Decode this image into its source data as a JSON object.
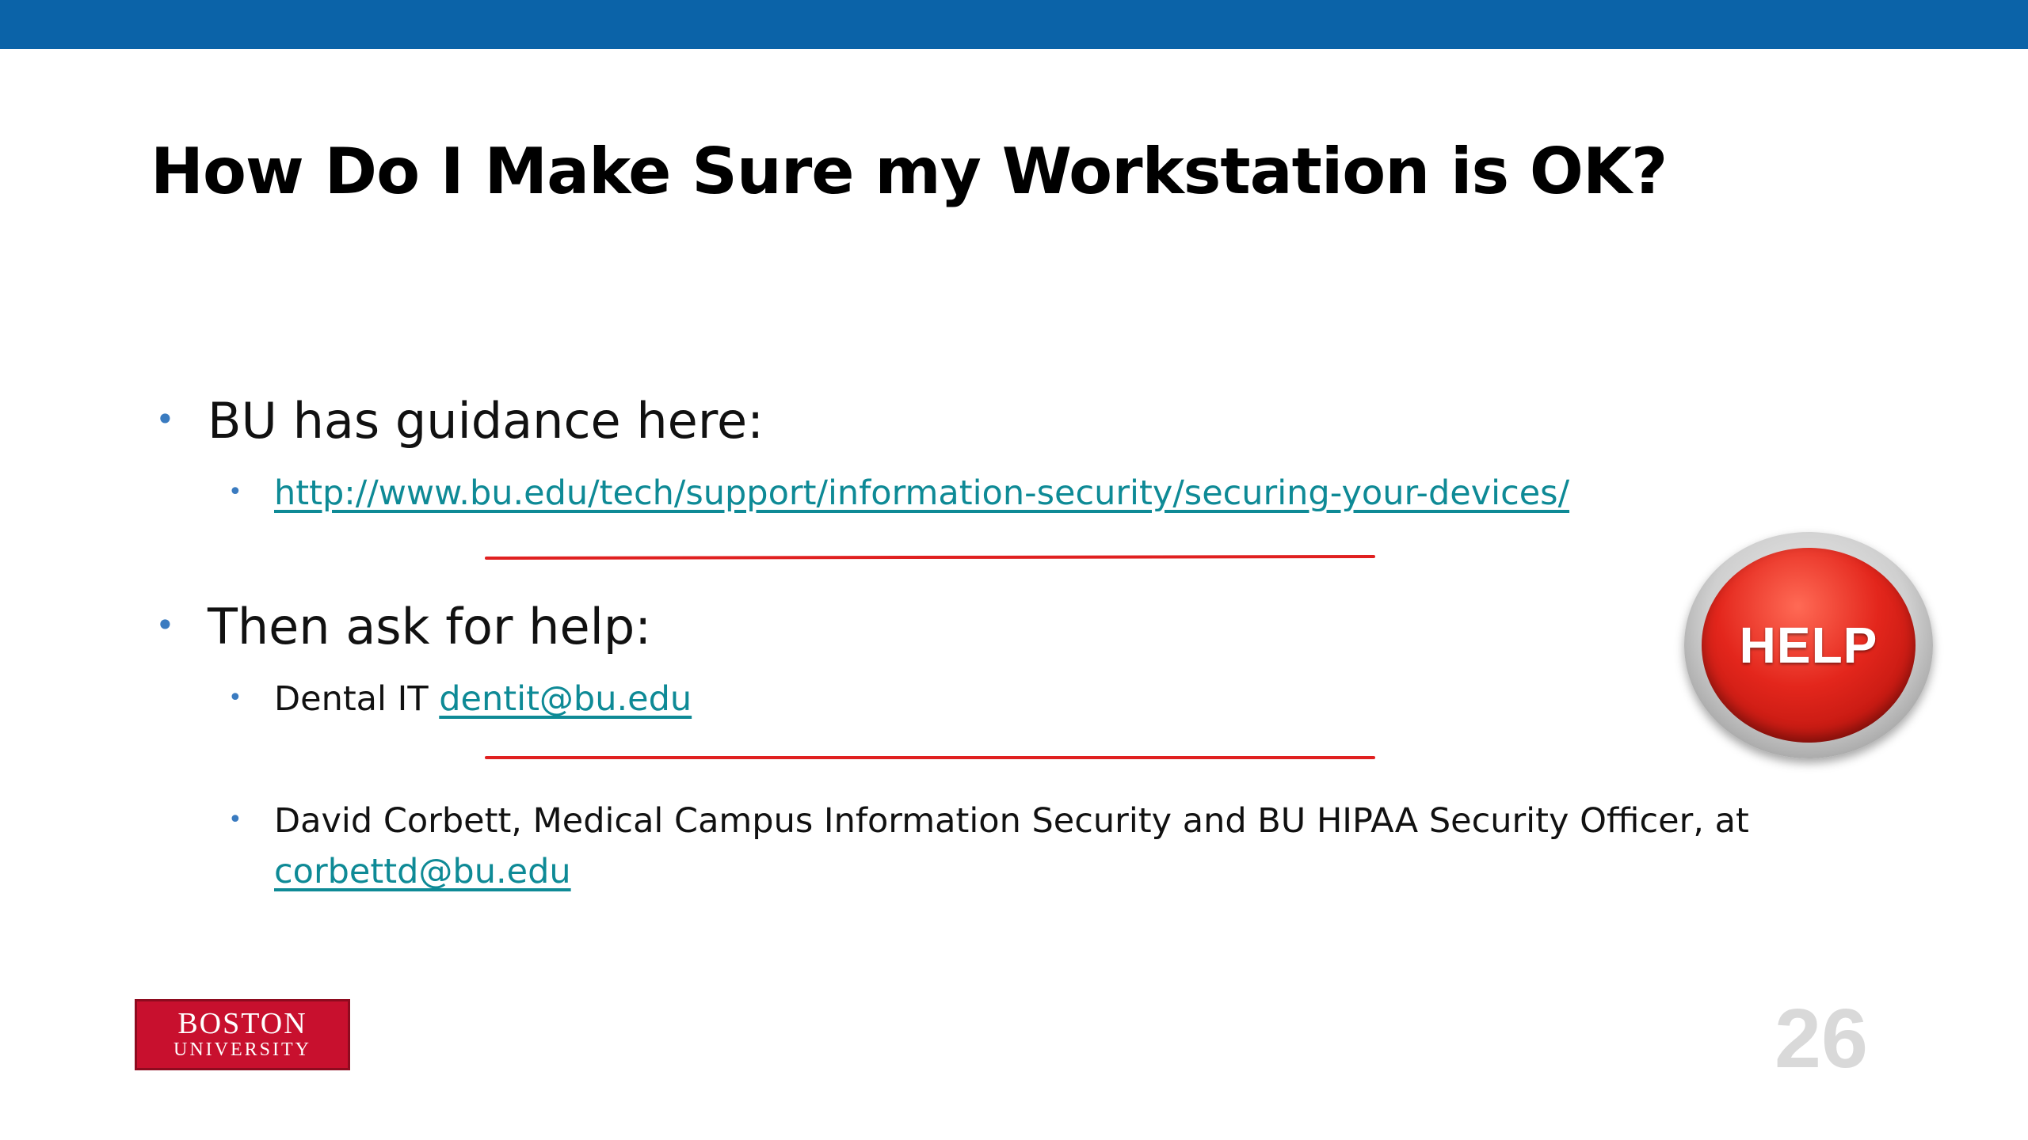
{
  "colors": {
    "header_bar": "#0b63a8",
    "bullet": "#3a7bc0",
    "link": "#0e8a96",
    "annotation_line": "#e02020",
    "logo_red": "#c8102e"
  },
  "slide": {
    "title": "How Do I Make Sure my Workstation is OK?",
    "bullets": [
      {
        "text": "BU has guidance here:",
        "sub": [
          {
            "link": "http://www.bu.edu/tech/support/information-security/securing-your-devices/"
          }
        ]
      },
      {
        "text": "Then ask for help:",
        "sub": [
          {
            "prefix": "Dental IT ",
            "link": "dentit@bu.edu"
          },
          {
            "text": "David Corbett, Medical Campus Information Security and BU HIPAA Security Officer, at",
            "link": "corbettd@bu.edu"
          }
        ]
      }
    ],
    "bullet_char": "•",
    "help_button": {
      "label": "HELP",
      "icon": "help-button-icon"
    },
    "logo": {
      "line1": "BOSTON",
      "line2": "UNIVERSITY"
    },
    "page_number": "26"
  }
}
